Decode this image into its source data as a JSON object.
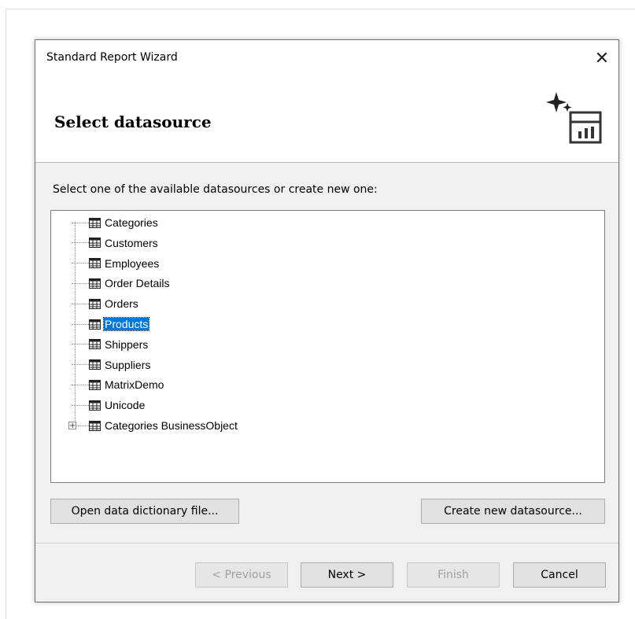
{
  "window": {
    "title": "Standard Report Wizard",
    "close_glyph": "✕"
  },
  "header": {
    "heading": "Select datasource",
    "icon": "wizard-sparkle-report-icon"
  },
  "content": {
    "instruction": "Select one of the available datasources or create new one:",
    "tree_items": [
      {
        "label": "Categories"
      },
      {
        "label": "Customers"
      },
      {
        "label": "Employees"
      },
      {
        "label": "Order Details"
      },
      {
        "label": "Orders"
      },
      {
        "label": "Products",
        "selected": true
      },
      {
        "label": "Shippers"
      },
      {
        "label": "Suppliers"
      },
      {
        "label": "MatrixDemo"
      },
      {
        "label": "Unicode"
      },
      {
        "label": "Categories BusinessObject",
        "expandable": true
      }
    ]
  },
  "buttons": {
    "open_dictionary": "Open data dictionary file...",
    "create_datasource": "Create new datasource...",
    "previous": "< Previous",
    "next": "Next >",
    "finish": "Finish",
    "cancel": "Cancel"
  },
  "colors": {
    "selection": "#0078d7",
    "dialog_bg": "#f0f0f0"
  }
}
